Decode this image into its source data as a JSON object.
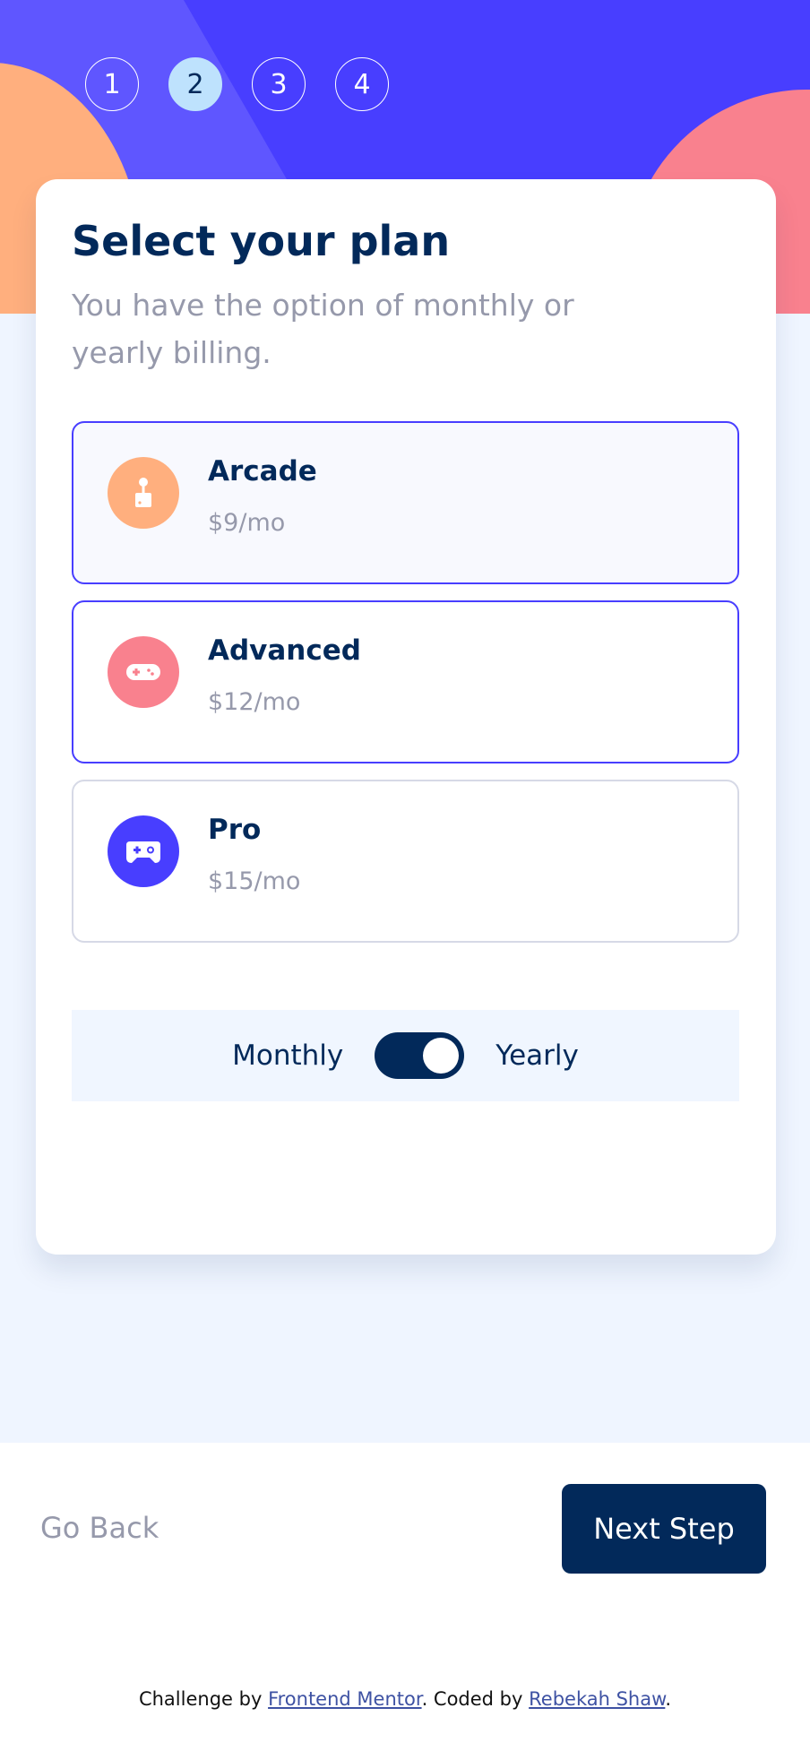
{
  "steps": [
    "1",
    "2",
    "3",
    "4"
  ],
  "active_step": "2",
  "heading": {
    "title": "Select your plan",
    "subtitle": "You have the option of monthly or yearly billing."
  },
  "plans": [
    {
      "name": "Arcade",
      "price": "$9/mo",
      "icon": "arcade-joystick-icon",
      "color": "#ffaf7e",
      "state": "selected"
    },
    {
      "name": "Advanced",
      "price": "$12/mo",
      "icon": "gamepad-icon",
      "color": "#f9818e",
      "state": "hover"
    },
    {
      "name": "Pro",
      "price": "$15/mo",
      "icon": "controller-icon",
      "color": "#483eff",
      "state": "default"
    }
  ],
  "billing": {
    "monthly_label": "Monthly",
    "yearly_label": "Yearly",
    "toggle_on": true
  },
  "nav": {
    "back_label": "Go Back",
    "next_label": "Next Step"
  },
  "footer": {
    "prefix": "Challenge by ",
    "link1": "Frontend Mentor",
    "middle": ". Coded by ",
    "link2": "Rebekah Shaw",
    "suffix": "."
  },
  "colors": {
    "accent": "#483eff",
    "primary": "#02295a",
    "muted": "#9699ab",
    "orange": "#ffaf7e",
    "pink": "#f9818e"
  }
}
